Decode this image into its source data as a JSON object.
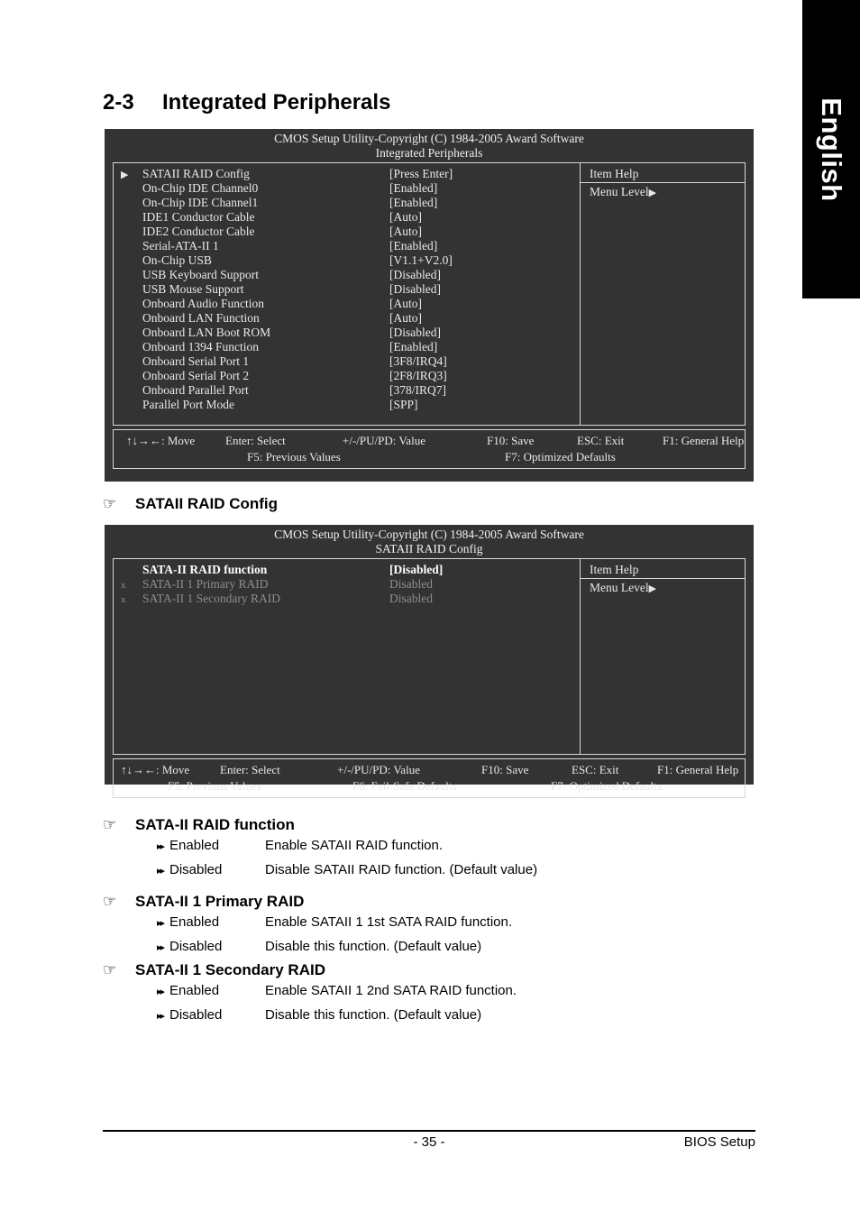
{
  "language_tab": {
    "label": "English"
  },
  "chapter": {
    "number": "2-3",
    "title": "Integrated Peripherals"
  },
  "bios_screens": [
    {
      "title_line1": "CMOS Setup Utility-Copyright (C) 1984-2005 Award Software",
      "title_line2": "Integrated Peripherals",
      "rows": [
        {
          "marker": "▶",
          "label": "SATAII RAID Config",
          "value": "[Press Enter]"
        },
        {
          "marker": "",
          "label": "On-Chip IDE Channel0",
          "value": "[Enabled]"
        },
        {
          "marker": "",
          "label": "On-Chip IDE Channel1",
          "value": "[Enabled]"
        },
        {
          "marker": "",
          "label": "IDE1 Conductor Cable",
          "value": "[Auto]"
        },
        {
          "marker": "",
          "label": "IDE2 Conductor Cable",
          "value": "[Auto]"
        },
        {
          "marker": "",
          "label": "Serial-ATA-II 1",
          "value": "[Enabled]"
        },
        {
          "marker": "",
          "label": "On-Chip USB",
          "value": "[V1.1+V2.0]"
        },
        {
          "marker": "",
          "label": "USB Keyboard Support",
          "value": "[Disabled]"
        },
        {
          "marker": "",
          "label": "USB Mouse Support",
          "value": "[Disabled]"
        },
        {
          "marker": "",
          "label": "Onboard Audio Function",
          "value": "[Auto]"
        },
        {
          "marker": "",
          "label": "Onboard LAN Function",
          "value": "[Auto]"
        },
        {
          "marker": "",
          "label": "Onboard LAN Boot ROM",
          "value": "[Disabled]"
        },
        {
          "marker": "",
          "label": "Onboard 1394 Function",
          "value": "[Enabled]"
        },
        {
          "marker": "",
          "label": "Onboard Serial Port 1",
          "value": "[3F8/IRQ4]"
        },
        {
          "marker": "",
          "label": "Onboard Serial Port 2",
          "value": "[2F8/IRQ3]"
        },
        {
          "marker": "",
          "label": "Onboard Parallel Port",
          "value": "[378/IRQ7]"
        },
        {
          "marker": "",
          "label": "Parallel Port Mode",
          "value": "[SPP]"
        }
      ],
      "help_title": "Item Help",
      "help_level": "Menu Level",
      "help_level_arrow": "▶",
      "footer_line1": [
        "↑↓→←: Move",
        "Enter: Select",
        "+/-/PU/PD: Value",
        "F10: Save",
        "ESC: Exit",
        "F1: General Help"
      ],
      "footer_line2": [
        "F5: Previous Values",
        "F7: Optimized Defaults"
      ]
    },
    {
      "title_line1": "CMOS Setup Utility-Copyright (C) 1984-2005 Award Software",
      "title_line2": "SATAII RAID Config",
      "rows": [
        {
          "marker": "",
          "label": "SATA-II RAID function",
          "value": "[Disabled]",
          "style": "bold"
        },
        {
          "marker": "x",
          "label": "SATA-II 1 Primary RAID",
          "value": "Disabled",
          "style": "dim"
        },
        {
          "marker": "x",
          "label": "SATA-II 1 Secondary RAID",
          "value": "Disabled",
          "style": "dim"
        }
      ],
      "help_title": "Item Help",
      "help_level": "Menu Level",
      "help_level_arrow": "▶",
      "footer_line1": [
        "↑↓→←: Move",
        "Enter: Select",
        "+/-/PU/PD: Value",
        "F10: Save",
        "ESC: Exit",
        "F1: General Help"
      ],
      "footer_line2": [
        "F5: Previous Values",
        "F6: Fail-Safe Defaults",
        "F7: Optimized Defaults"
      ]
    }
  ],
  "sections": [
    {
      "glyph": "☞",
      "title": "SATAII RAID Config",
      "options": []
    },
    {
      "glyph": "☞",
      "title": "SATA-II RAID function",
      "options": [
        {
          "bullet": "▸▸",
          "name": "Enabled",
          "desc": "Enable SATAII RAID function."
        },
        {
          "bullet": "▸▸",
          "name": "Disabled",
          "desc": "Disable SATAII RAID function. (Default value)"
        }
      ]
    },
    {
      "glyph": "☞",
      "title": "SATA-II 1 Primary RAID",
      "options": [
        {
          "bullet": "▸▸",
          "name": "Enabled",
          "desc": "Enable SATAII 1 1st SATA RAID function."
        },
        {
          "bullet": "▸▸",
          "name": "Disabled",
          "desc": "Disable this function. (Default value)"
        }
      ]
    },
    {
      "glyph": "☞",
      "title": "SATA-II 1 Secondary RAID",
      "options": [
        {
          "bullet": "▸▸",
          "name": "Enabled",
          "desc": "Enable SATAII 1 2nd SATA RAID function."
        },
        {
          "bullet": "▸▸",
          "name": "Disabled",
          "desc": "Disable this function. (Default value)"
        }
      ]
    }
  ],
  "page_footer": {
    "page_number": "- 35 -",
    "right_label": "BIOS Setup"
  }
}
